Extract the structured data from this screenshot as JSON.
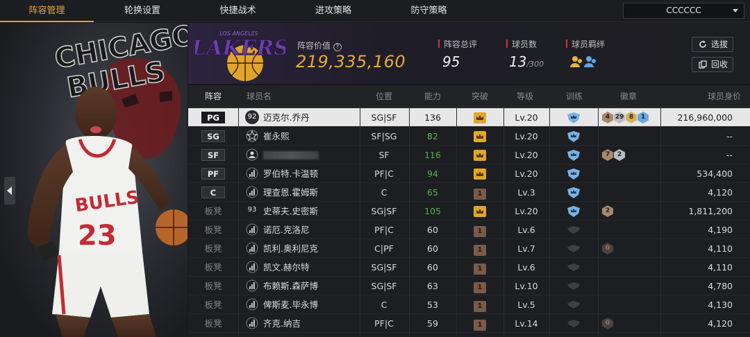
{
  "tabs": [
    {
      "label": "阵容管理",
      "active": true
    },
    {
      "label": "轮换设置",
      "active": false
    },
    {
      "label": "快捷战术",
      "active": false
    },
    {
      "label": "进攻策略",
      "active": false
    },
    {
      "label": "防守策略",
      "active": false
    }
  ],
  "team_select": {
    "value": "CCCCCC"
  },
  "hero": {
    "backdrop_text_1": "CHICAGO",
    "backdrop_text_2": "BULLS",
    "jersey_text": "BULLS",
    "jersey_number": "23"
  },
  "summary": {
    "logo_text": "LAKERS",
    "logo_subtext": "LOS ANGELES",
    "value_label": "阵容价值",
    "value": "219,335,160",
    "rating_label": "阵容总评",
    "rating": "95",
    "players_label": "球员数",
    "players": "13",
    "players_max": "/300",
    "bonds_label": "球员羁绊",
    "select_button": "选拔",
    "recycle_button": "回收"
  },
  "columns": [
    "阵容",
    "球员名",
    "位置",
    "能力",
    "突破",
    "等级",
    "训练",
    "徽章",
    "球员身价"
  ],
  "rows": [
    {
      "slot": "PG",
      "slot_type": "badge",
      "icon": "92",
      "icon_type": "circle",
      "name": "迈克尔.乔丹",
      "pos": "SG|SF",
      "ability": "136",
      "ability_color": "normal",
      "break": "gold",
      "level": "Lv.20",
      "train": "blue",
      "medals": [
        {
          "t": "4",
          "c": "bronze"
        },
        {
          "t": "29",
          "c": "silver"
        },
        {
          "t": "8",
          "c": "gold"
        },
        {
          "t": "1",
          "c": "blue"
        }
      ],
      "value": "216,960,000",
      "selected": true
    },
    {
      "slot": "SG",
      "slot_type": "badge",
      "icon": "star",
      "icon_type": "glyph",
      "name": "崔永熙",
      "pos": "SF|SG",
      "ability": "82",
      "ability_color": "green",
      "break": "gold",
      "level": "Lv.20",
      "train": "blue",
      "medals": [],
      "value": "--"
    },
    {
      "slot": "SF",
      "slot_type": "badge",
      "icon": "person",
      "icon_type": "glyph",
      "name": "",
      "pos": "SF",
      "ability": "116",
      "ability_color": "green",
      "break": "gold",
      "level": "Lv.20",
      "train": "blue",
      "medals": [
        {
          "t": "7",
          "c": "bronze"
        },
        {
          "t": "2",
          "c": "silver"
        }
      ],
      "value": "--",
      "masked": true
    },
    {
      "slot": "PF",
      "slot_type": "badge",
      "icon": "bars",
      "icon_type": "glyph",
      "name": "罗伯特.卡温顿",
      "pos": "PF|C",
      "ability": "94",
      "ability_color": "green",
      "break": "gold",
      "level": "Lv.20",
      "train": "blue",
      "medals": [],
      "value": "534,400"
    },
    {
      "slot": "C",
      "slot_type": "badge",
      "icon": "bars",
      "icon_type": "glyph",
      "name": "理查恩.霍姆斯",
      "pos": "C",
      "ability": "65",
      "ability_color": "green",
      "break": "brown",
      "break_text": "1",
      "level": "Lv.3",
      "train": "blue",
      "medals": [],
      "value": "4,120"
    },
    {
      "slot": "板凳",
      "slot_type": "text",
      "icon": "93",
      "icon_type": "plain",
      "name": "史蒂夫.史密斯",
      "pos": "SG|SF",
      "ability": "105",
      "ability_color": "green",
      "break": "gold",
      "level": "Lv.20",
      "train": "blue",
      "medals": [
        {
          "t": "2",
          "c": "bronze"
        }
      ],
      "value": "1,811,200"
    },
    {
      "slot": "板凳",
      "slot_type": "text",
      "icon": "bars",
      "icon_type": "glyph",
      "name": "诺厄.克洛尼",
      "pos": "PF|C",
      "ability": "60",
      "ability_color": "normal",
      "break": "brown",
      "break_text": "1",
      "level": "Lv.6",
      "train": "grey",
      "medals": [],
      "value": "4,190"
    },
    {
      "slot": "板凳",
      "slot_type": "text",
      "icon": "bars",
      "icon_type": "glyph",
      "name": "凯利.奥利尼克",
      "pos": "C|PF",
      "ability": "60",
      "ability_color": "normal",
      "break": "brown",
      "break_text": "1",
      "level": "Lv.7",
      "train": "grey",
      "medals": [
        {
          "t": "0",
          "c": "dark"
        }
      ],
      "value": "4,110"
    },
    {
      "slot": "板凳",
      "slot_type": "text",
      "icon": "bars",
      "icon_type": "glyph",
      "name": "凯文.赫尔特",
      "pos": "SG|SF",
      "ability": "60",
      "ability_color": "normal",
      "break": "brown",
      "break_text": "1",
      "level": "Lv.6",
      "train": "grey",
      "medals": [],
      "value": "4,110"
    },
    {
      "slot": "板凳",
      "slot_type": "text",
      "icon": "bars",
      "icon_type": "glyph",
      "name": "布赖斯.森萨博",
      "pos": "SG|SF",
      "ability": "63",
      "ability_color": "normal",
      "break": "brown",
      "break_text": "1",
      "level": "Lv.10",
      "train": "grey",
      "medals": [],
      "value": "4,780"
    },
    {
      "slot": "板凳",
      "slot_type": "text",
      "icon": "bars",
      "icon_type": "glyph",
      "name": "俾斯麦.毕永博",
      "pos": "C",
      "ability": "53",
      "ability_color": "normal",
      "break": "brown",
      "break_text": "1",
      "level": "Lv.5",
      "train": "grey",
      "medals": [],
      "value": "4,130"
    },
    {
      "slot": "板凳",
      "slot_type": "text",
      "icon": "bars",
      "icon_type": "glyph",
      "name": "齐克.纳吉",
      "pos": "PF|C",
      "ability": "59",
      "ability_color": "normal",
      "break": "brown",
      "break_text": "1",
      "level": "Lv.14",
      "train": "grey",
      "medals": [
        {
          "t": "0",
          "c": "dark"
        }
      ],
      "value": "4,120"
    }
  ],
  "colors": {
    "accent": "#e9a13a",
    "green": "#54b04a",
    "bronze": "#a9876a",
    "silver": "#b9bcc2",
    "gold": "#d8b15a",
    "blue": "#6aa8e0"
  }
}
